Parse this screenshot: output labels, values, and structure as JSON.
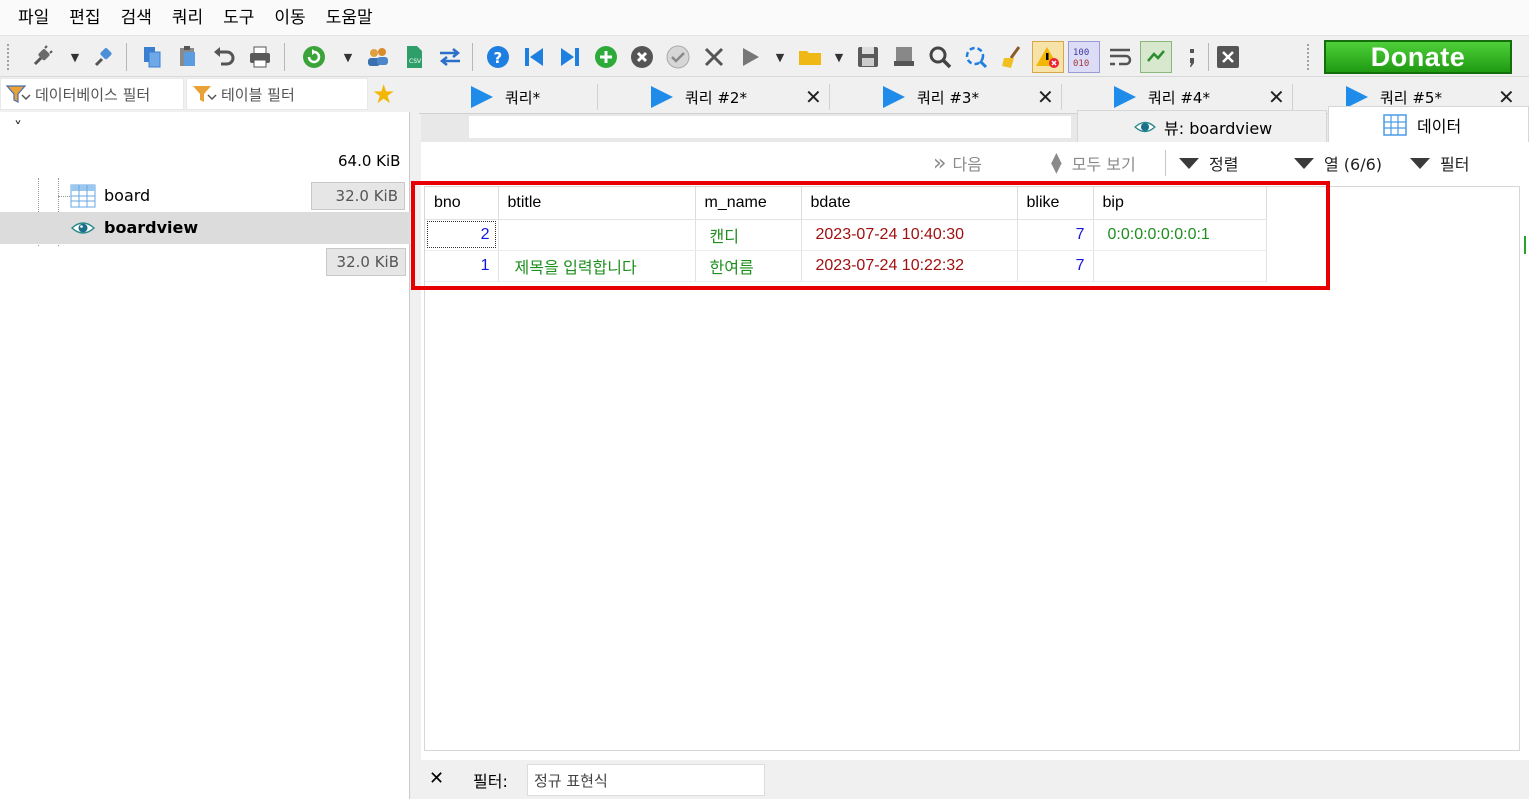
{
  "menu": [
    "파일",
    "편집",
    "검색",
    "쿼리",
    "도구",
    "이동",
    "도움말"
  ],
  "donate_label": "Donate",
  "left": {
    "db_filter_placeholder": "데이터베이스 필터",
    "table_filter_placeholder": "테이블 필터",
    "expand_glyph": "˅",
    "total_size": "64.0 KiB",
    "items": [
      {
        "name": "board",
        "size": "32.0 KiB",
        "icon": "table-icon"
      },
      {
        "name": "boardview",
        "size": "32.0 KiB",
        "icon": "view-eye-icon"
      }
    ]
  },
  "query_tabs": [
    "쿼리*",
    "쿼리 #2*",
    "쿼리 #3*",
    "쿼리 #4*",
    "쿼리 #5*"
  ],
  "sub_tabs": {
    "view": "뷰: boardview",
    "data": "데이터"
  },
  "grid_toolbar": {
    "next": "다음",
    "show_all": "모두 보기",
    "sort": "정렬",
    "columns": "열 (6/6)",
    "filter": "필터"
  },
  "columns": [
    "bno",
    "btitle",
    "m_name",
    "bdate",
    "blike",
    "bip"
  ],
  "rows": [
    {
      "bno": "2",
      "btitle": "",
      "m_name": "캔디",
      "bdate": "2023-07-24 10:40:30",
      "blike": "7",
      "bip": "0:0:0:0:0:0:0:1"
    },
    {
      "bno": "1",
      "btitle": "제목을 입력합니다",
      "m_name": "한여름",
      "bdate": "2023-07-24 10:22:32",
      "blike": "7",
      "bip": ""
    }
  ],
  "bottom": {
    "close_glyph": "✕",
    "filter_label": "필터:",
    "filter_placeholder": "정규 표현식"
  },
  "colors": {
    "highlight": "#e80000",
    "number": "#1515e0",
    "string": "#1d8f1d",
    "datetime": "#a01010",
    "donate": "#2bb31c"
  }
}
